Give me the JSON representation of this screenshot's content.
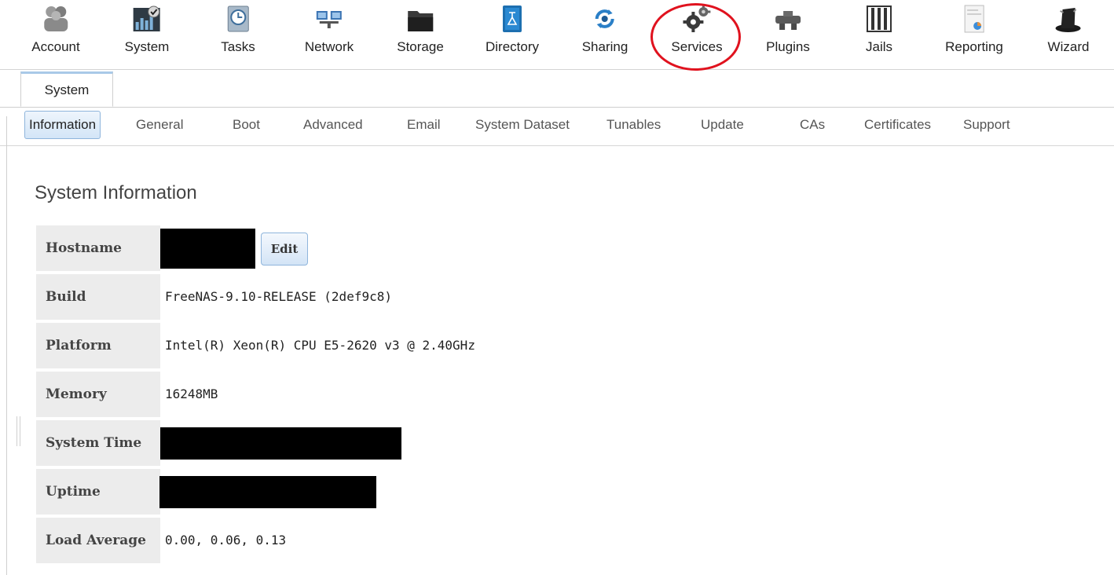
{
  "toolbar": {
    "items": [
      {
        "label": "Account",
        "icon": "account-icon"
      },
      {
        "label": "System",
        "icon": "system-icon"
      },
      {
        "label": "Tasks",
        "icon": "tasks-icon"
      },
      {
        "label": "Network",
        "icon": "network-icon"
      },
      {
        "label": "Storage",
        "icon": "storage-icon"
      },
      {
        "label": "Directory",
        "icon": "directory-icon"
      },
      {
        "label": "Sharing",
        "icon": "sharing-icon"
      },
      {
        "label": "Services",
        "icon": "gears-icon"
      },
      {
        "label": "Plugins",
        "icon": "plugins-icon"
      },
      {
        "label": "Jails",
        "icon": "jails-icon"
      },
      {
        "label": "Reporting",
        "icon": "reporting-icon"
      },
      {
        "label": "Wizard",
        "icon": "wizard-hat-icon"
      }
    ],
    "highlight_color": "#e0121e"
  },
  "main_tabs": [
    {
      "label": "System",
      "active": true
    }
  ],
  "sub_tabs": [
    {
      "label": "Information",
      "active": true
    },
    {
      "label": "General"
    },
    {
      "label": "Boot"
    },
    {
      "label": "Advanced"
    },
    {
      "label": "Email"
    },
    {
      "label": "System Dataset"
    },
    {
      "label": "Tunables"
    },
    {
      "label": "Update"
    },
    {
      "label": "CAs"
    },
    {
      "label": "Certificates"
    },
    {
      "label": "Support"
    }
  ],
  "section_title": "System Information",
  "info": {
    "rows": [
      {
        "key": "Hostname",
        "value": ""
      },
      {
        "key": "Build",
        "value": "FreeNAS-9.10-RELEASE (2def9c8)"
      },
      {
        "key": "Platform",
        "value": "Intel(R) Xeon(R) CPU E5-2620 v3 @ 2.40GHz"
      },
      {
        "key": "Memory",
        "value": "16248MB"
      },
      {
        "key": "System Time",
        "value": ""
      },
      {
        "key": "Uptime",
        "value": ""
      },
      {
        "key": "Load Average",
        "value": "0.00, 0.06, 0.13"
      }
    ],
    "edit_label": "Edit"
  },
  "colors": {
    "active_tab_border": "#8fb5dc",
    "key_cell_bg": "#ececec",
    "redaction": "#000000"
  }
}
